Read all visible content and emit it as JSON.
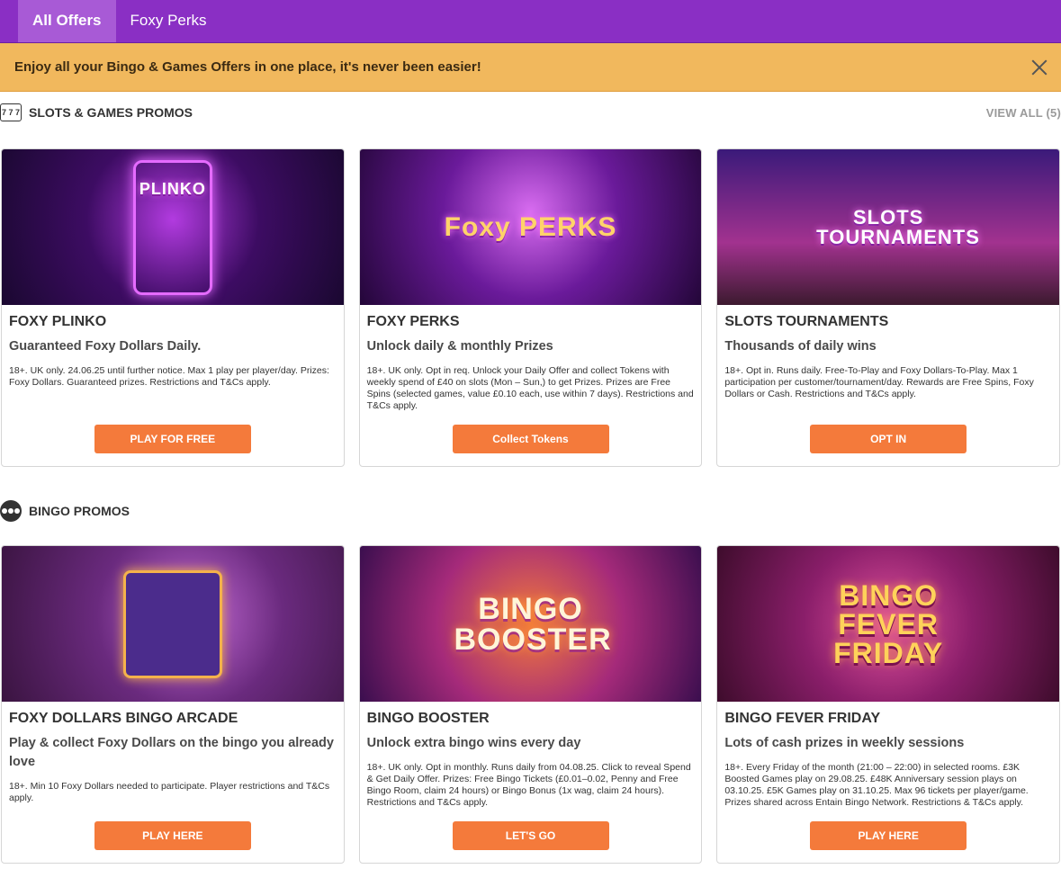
{
  "nav": {
    "tabs": [
      {
        "label": "All Offers",
        "active": true
      },
      {
        "label": "Foxy Perks",
        "active": false
      }
    ]
  },
  "banner": {
    "text": "Enjoy all your Bingo & Games Offers in one place, it's never been easier!"
  },
  "slots_section": {
    "title": "SLOTS & GAMES PROMOS",
    "view_all": "VIEW ALL (5)",
    "icon_text": "7 7 7",
    "cards": [
      {
        "image_text": "PLINKO",
        "title": "FOXY PLINKO",
        "subtitle": "Guaranteed Foxy Dollars Daily.",
        "terms": "18+. UK only. 24.06.25 until further notice. Max 1 play per player/day. Prizes: Foxy Dollars. Guaranteed prizes. Restrictions and T&Cs apply.",
        "button": "PLAY FOR FREE"
      },
      {
        "image_text": "Foxy PERKS",
        "title": "FOXY PERKS",
        "subtitle": "Unlock daily & monthly Prizes",
        "terms": "18+. UK only. Opt in req. Unlock your Daily Offer and collect Tokens with weekly spend of £40 on slots (Mon – Sun,) to get Prizes. Prizes are Free Spins (selected games, value £0.10 each, use within 7 days). Restrictions and T&Cs apply.",
        "button": "Collect Tokens"
      },
      {
        "image_text": "SLOTS TOURNAMENTS",
        "title": "SLOTS TOURNAMENTS",
        "subtitle": "Thousands of daily wins",
        "terms": "18+. Opt in. Runs daily. Free-To-Play and Foxy Dollars-To-Play. Max 1 participation per customer/tournament/day. Rewards are Free Spins, Foxy Dollars or Cash. Restrictions and T&Cs apply.",
        "button": "OPT IN"
      }
    ]
  },
  "bingo_section": {
    "title": "BINGO PROMOS",
    "cards": [
      {
        "image_text": "",
        "title": "FOXY DOLLARS BINGO ARCADE",
        "subtitle": "Play & collect Foxy Dollars on the bingo you already love",
        "terms": "18+. Min 10 Foxy Dollars needed to participate. Player restrictions and T&Cs apply.",
        "button": "PLAY HERE"
      },
      {
        "image_text": "BINGO BOOSTER",
        "title": "BINGO BOOSTER",
        "subtitle": "Unlock extra bingo wins every day",
        "terms": "18+. UK only. Opt in monthly. Runs daily from 04.08.25. Click to reveal Spend & Get Daily Offer. Prizes: Free Bingo Tickets (£0.01–0.02, Penny and Free Bingo Room, claim 24 hours) or Bingo Bonus (1x wag, claim 24 hours). Restrictions and T&Cs apply.",
        "button": "LET'S GO"
      },
      {
        "image_text": "BINGO FEVER FRIDAY",
        "title": "BINGO FEVER FRIDAY",
        "subtitle": "Lots of cash prizes in weekly sessions",
        "terms": "18+. Every Friday of the month (21:00 – 22:00) in selected rooms. £3K Boosted Games play on 29.08.25. £48K Anniversary session plays on 03.10.25. £5K Games play on 31.10.25. Max 96 tickets per player/game. Prizes shared across Entain Bingo Network. Restrictions & T&Cs apply.",
        "button": "PLAY HERE"
      }
    ]
  },
  "colors": {
    "nav": "#8a2fc4",
    "banner": "#f1b85d",
    "button": "#f47a3b"
  }
}
